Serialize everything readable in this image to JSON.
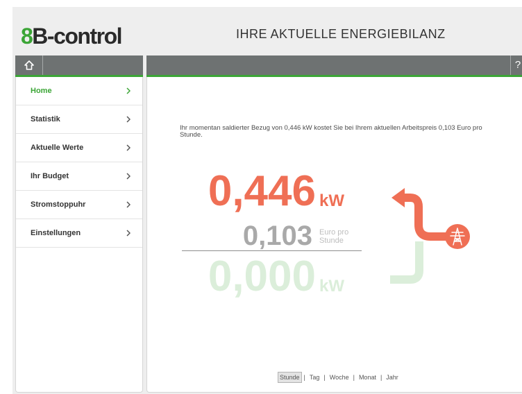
{
  "header": {
    "logo_mark": "8",
    "logo_text": "B-control",
    "title": "IHRE AKTUELLE ENERGIEBILANZ"
  },
  "toolbar": {
    "home_icon": "home-icon",
    "help_label": "?"
  },
  "sidebar": {
    "item_icon": "chevron-right-icon",
    "items": [
      {
        "label": "Home",
        "active": true
      },
      {
        "label": "Statistik",
        "active": false
      },
      {
        "label": "Aktuelle Werte",
        "active": false
      },
      {
        "label": "Ihr Budget",
        "active": false
      },
      {
        "label": "Stromstoppuhr",
        "active": false
      },
      {
        "label": "Einstellungen",
        "active": false
      }
    ]
  },
  "main": {
    "description": "Ihr momentan saldierter Bezug von 0,446 kW kostet Sie bei Ihrem aktuellen Arbeitspreis 0,103 Euro pro Stunde.",
    "consumption": {
      "value": "0,446",
      "unit": "kW"
    },
    "price": {
      "value": "0,103",
      "unit": "Euro pro Stunde"
    },
    "feed_in": {
      "value": "0,000",
      "unit": "kW"
    },
    "flow_icon": "power-pylon-icon",
    "period_separator": "|",
    "periods": [
      {
        "label": "Stunde",
        "selected": true
      },
      {
        "label": "Tag",
        "selected": false
      },
      {
        "label": "Woche",
        "selected": false
      },
      {
        "label": "Monat",
        "selected": false
      },
      {
        "label": "Jahr",
        "selected": false
      }
    ]
  },
  "colors": {
    "accent_green": "#3ba536",
    "toolbar_gray": "#6e7272",
    "consumption": "#ef6f55",
    "price": "#a9a9a9",
    "feed_in": "#dbeeda"
  }
}
